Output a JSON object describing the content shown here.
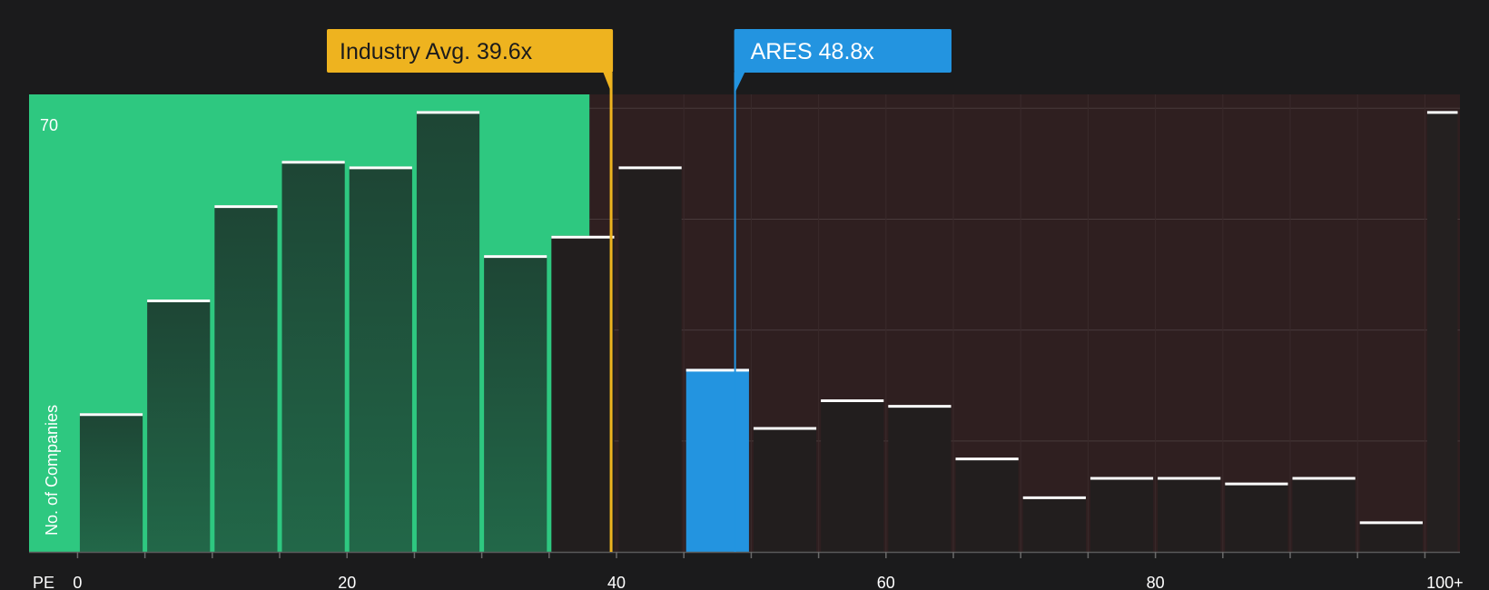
{
  "chart_data": {
    "type": "bar",
    "bins": [
      {
        "x0": 0,
        "x1": 5,
        "value": 25
      },
      {
        "x0": 5,
        "x1": 10,
        "value": 45.5
      },
      {
        "x0": 10,
        "x1": 15,
        "value": 62.5
      },
      {
        "x0": 15,
        "x1": 20,
        "value": 70.5
      },
      {
        "x0": 20,
        "x1": 25,
        "value": 69.5
      },
      {
        "x0": 25,
        "x1": 30,
        "value": 79.5
      },
      {
        "x0": 30,
        "x1": 35,
        "value": 53.5
      },
      {
        "x0": 35,
        "x1": 40,
        "value": 57
      },
      {
        "x0": 40,
        "x1": 45,
        "value": 69.5
      },
      {
        "x0": 45,
        "x1": 50,
        "value": 33
      },
      {
        "x0": 50,
        "x1": 55,
        "value": 22.5
      },
      {
        "x0": 55,
        "x1": 60,
        "value": 27.5
      },
      {
        "x0": 60,
        "x1": 65,
        "value": 26.5
      },
      {
        "x0": 65,
        "x1": 70,
        "value": 17
      },
      {
        "x0": 70,
        "x1": 75,
        "value": 10
      },
      {
        "x0": 75,
        "x1": 80,
        "value": 13.5
      },
      {
        "x0": 80,
        "x1": 85,
        "value": 13.5
      },
      {
        "x0": 85,
        "x1": 90,
        "value": 12.5
      },
      {
        "x0": 90,
        "x1": 95,
        "value": 13.5
      },
      {
        "x0": 95,
        "x1": 100,
        "value": 5.5
      },
      {
        "x0": 100,
        "x1": 102.6,
        "value": 79.5
      }
    ],
    "highlight_bin_index": 9,
    "x_ticks": [
      {
        "value": 0,
        "label": "0"
      },
      {
        "value": 20,
        "label": "20"
      },
      {
        "value": 40,
        "label": "40"
      },
      {
        "value": 60,
        "label": "60"
      },
      {
        "value": 80,
        "label": "80"
      },
      {
        "value": 100,
        "label": "100+"
      }
    ],
    "xlim": [
      -3.6,
      102.6
    ],
    "ylim": [
      0,
      82.5
    ],
    "y_gridlines": [
      20,
      40,
      60,
      80
    ],
    "y_tick_label": "70",
    "xlabel": "PE",
    "ylabel": "No. of Companies",
    "zones": [
      {
        "name": "undervalued",
        "x0": -3.6,
        "x1": 38,
        "color": "#2ec880"
      },
      {
        "name": "overvalued",
        "x0": 38,
        "x1": 102.6,
        "color": "#2f1f20"
      }
    ],
    "industry_avg": {
      "label": "Industry Avg. 39.6x",
      "value": 39.6,
      "color": "#eeb31f"
    },
    "company": {
      "label": "ARES 48.8x",
      "value": 48.8,
      "color": "#2394e0"
    }
  }
}
